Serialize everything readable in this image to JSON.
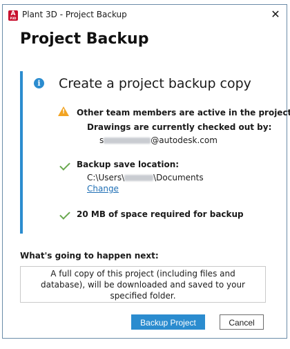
{
  "window": {
    "title": "Plant 3D - Project Backup",
    "app_icon_letter": "A",
    "app_icon_sub": "P3D",
    "close_glyph": "✕"
  },
  "heading": "Project Backup",
  "panel": {
    "title": "Create a project backup copy",
    "info_glyph": "i",
    "warning": {
      "title": "Other team members are active in the project",
      "subtitle": "Drawings are currently checked out by:",
      "user_prefix": "s",
      "user_suffix": "@autodesk.com"
    },
    "backup_location": {
      "label": "Backup save location:",
      "path_prefix": "C:\\Users\\",
      "path_suffix": "\\Documents",
      "change_link": "Change"
    },
    "space_required": "20 MB of space required for backup"
  },
  "next": {
    "label": "What's going to happen next:",
    "line1": "A full copy of this project (including files and",
    "line2": "database), will be downloaded and saved to your",
    "line3": "specified folder."
  },
  "buttons": {
    "primary": "Backup Project",
    "cancel": "Cancel"
  },
  "colors": {
    "accent": "#2b8ccf",
    "warning": "#f2a423",
    "success": "#6aa84f",
    "brand": "#c8102e"
  }
}
